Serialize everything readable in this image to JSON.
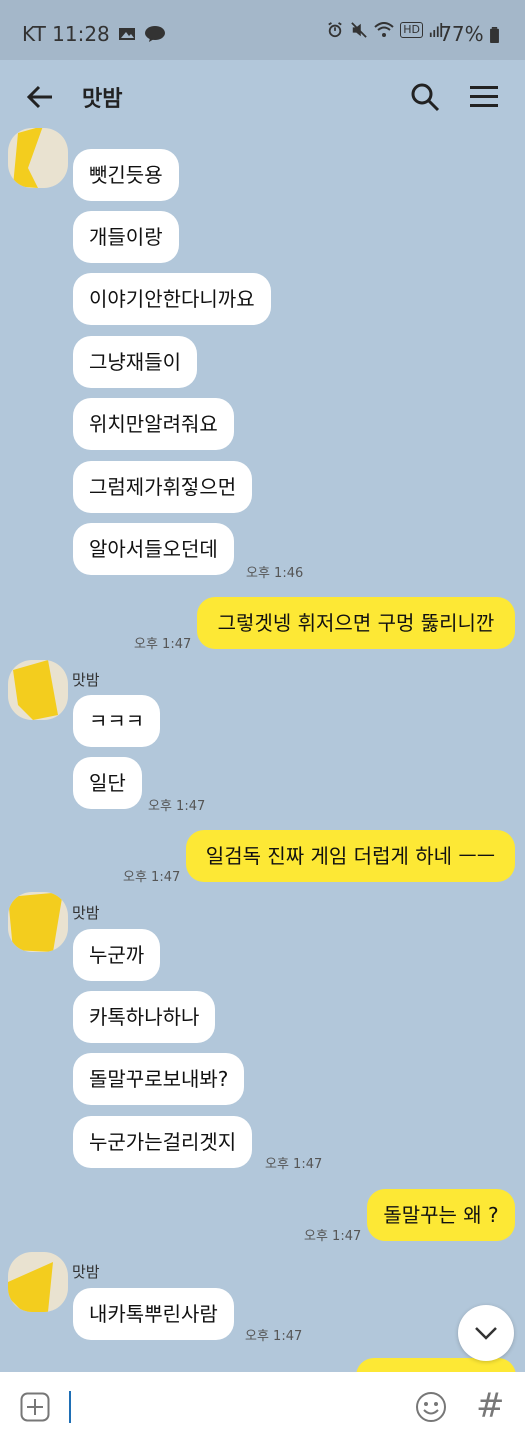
{
  "status_bar": {
    "carrier_time": "KT 11:28",
    "hd_badge": "HD",
    "battery": "77%"
  },
  "header": {
    "title": "맛밤"
  },
  "messages": [
    {
      "sender": "맛밤",
      "text": "뺏긴듯용"
    },
    {
      "sender": "맛밤",
      "text": "개들이랑"
    },
    {
      "sender": "맛밤",
      "text": "이야기안한다니까요"
    },
    {
      "sender": "맛밤",
      "text": "그냥재들이"
    },
    {
      "sender": "맛밤",
      "text": "위치만알려줘요"
    },
    {
      "sender": "맛밤",
      "text": "그럼제가휘젛으먼"
    },
    {
      "sender": "맛밤",
      "text": "알아서들오던데",
      "time": "오후 1:46"
    },
    {
      "sender": "me",
      "text": "그렇겟넹 휘저으면 구멍 뚫리니깐",
      "time": "오후 1:47"
    },
    {
      "sender": "맛밤",
      "sender_label": "맛밤",
      "text": "ㅋㅋㅋ"
    },
    {
      "sender": "맛밤",
      "text": "일단",
      "time": "오후 1:47"
    },
    {
      "sender": "me",
      "text": "일검독 진짜 게임 더럽게 하네 ㅡㅡ",
      "time": "오후 1:47"
    },
    {
      "sender": "맛밤",
      "sender_label": "맛밤",
      "text": "누군까"
    },
    {
      "sender": "맛밤",
      "text": "카톡하나하나"
    },
    {
      "sender": "맛밤",
      "text": "돌말꾸로보내봐?"
    },
    {
      "sender": "맛밤",
      "text": "누군가는걸리겟지",
      "time": "오후 1:47"
    },
    {
      "sender": "me",
      "text": "돌말꾸는 왜 ?",
      "time": "오후 1:47"
    },
    {
      "sender": "맛밤",
      "sender_label": "맛밤",
      "text": "내카톡뿌린사람",
      "time": "오후 1:47"
    }
  ],
  "icons": {
    "back": "arrow-left-icon",
    "search": "search-icon",
    "menu": "hamburger-menu-icon",
    "scroll_down": "chevron-down-icon",
    "add": "plus-box-icon",
    "emoji": "smiley-icon",
    "hash": "#"
  },
  "colors": {
    "background": "#b2c7da",
    "incoming_bubble": "#ffffff",
    "outgoing_bubble": "#fde835",
    "status_bar": "#a4b7c9"
  }
}
